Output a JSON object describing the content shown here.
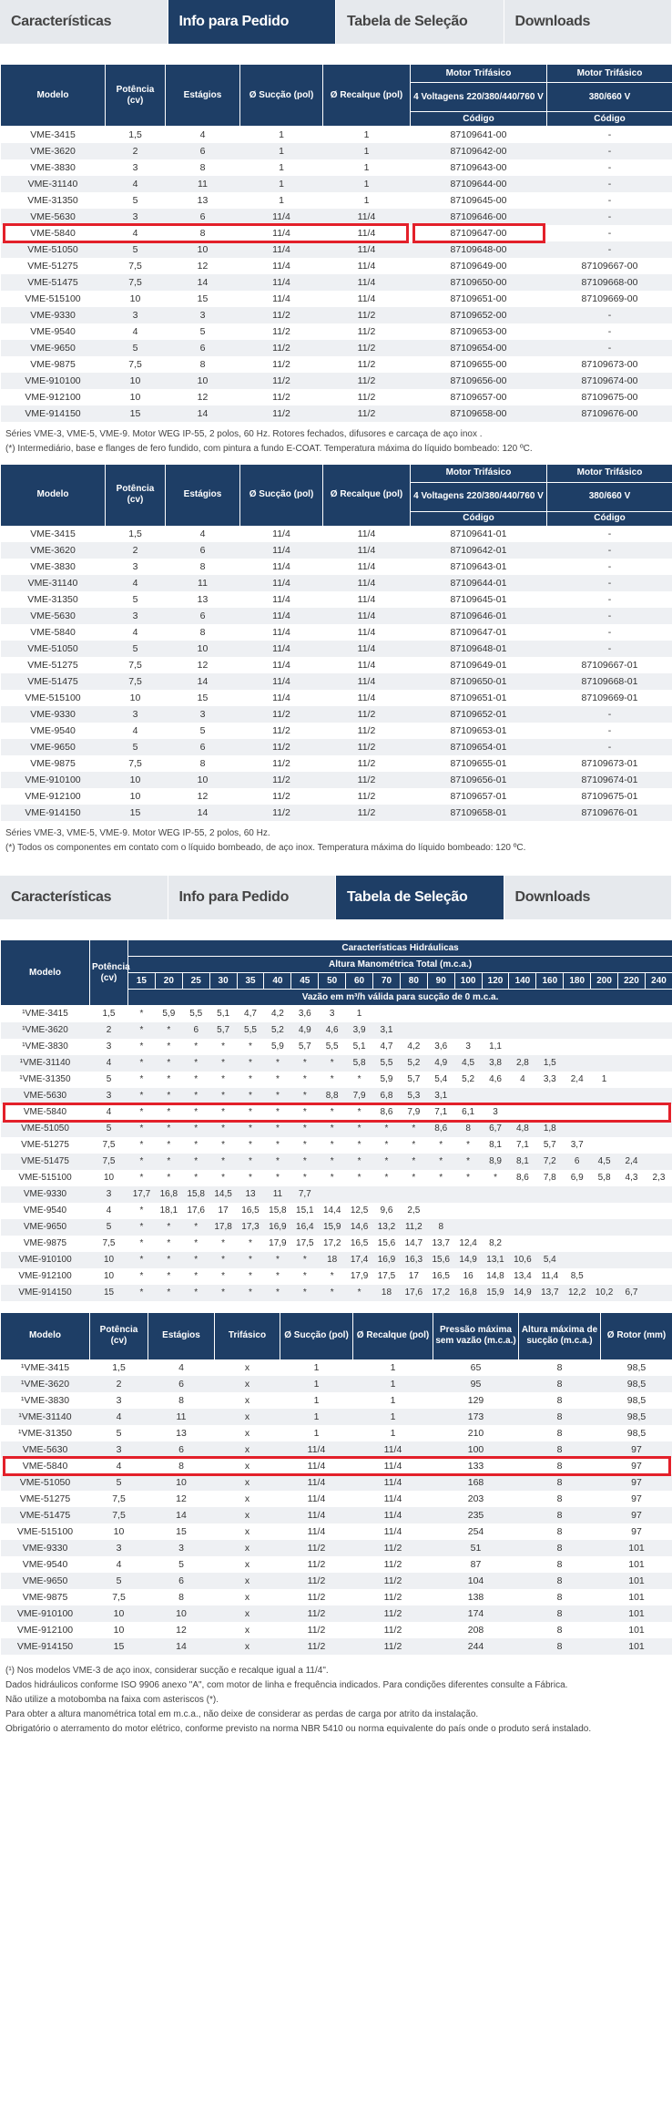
{
  "tabs": [
    "Características",
    "Info para Pedido",
    "Tabela de Seleção",
    "Downloads"
  ],
  "order_head": {
    "modelo": "Modelo",
    "potencia": "Potência (cv)",
    "estagios": "Estágios",
    "succao": "Ø Sucção (pol)",
    "recalque": "Ø Recalque (pol)",
    "motor1": "Motor Trifásico",
    "motor1_sub": "4 Voltagens 220/380/440/760 V",
    "motor2": "Motor Trifásico",
    "motor2_sub": "380/660 V",
    "codigo": "Código"
  },
  "order1": [
    [
      "VME-3415",
      "1,5",
      "4",
      "1",
      "1",
      "87109641-00",
      "-"
    ],
    [
      "VME-3620",
      "2",
      "6",
      "1",
      "1",
      "87109642-00",
      "-"
    ],
    [
      "VME-3830",
      "3",
      "8",
      "1",
      "1",
      "87109643-00",
      "-"
    ],
    [
      "VME-31140",
      "4",
      "11",
      "1",
      "1",
      "87109644-00",
      "-"
    ],
    [
      "VME-31350",
      "5",
      "13",
      "1",
      "1",
      "87109645-00",
      "-"
    ],
    [
      "VME-5630",
      "3",
      "6",
      "11/4",
      "11/4",
      "87109646-00",
      "-"
    ],
    [
      "VME-5840",
      "4",
      "8",
      "11/4",
      "11/4",
      "87109647-00",
      "-"
    ],
    [
      "VME-51050",
      "5",
      "10",
      "11/4",
      "11/4",
      "87109648-00",
      "-"
    ],
    [
      "VME-51275",
      "7,5",
      "12",
      "11/4",
      "11/4",
      "87109649-00",
      "87109667-00"
    ],
    [
      "VME-51475",
      "7,5",
      "14",
      "11/4",
      "11/4",
      "87109650-00",
      "87109668-00"
    ],
    [
      "VME-515100",
      "10",
      "15",
      "11/4",
      "11/4",
      "87109651-00",
      "87109669-00"
    ],
    [
      "VME-9330",
      "3",
      "3",
      "11/2",
      "11/2",
      "87109652-00",
      "-"
    ],
    [
      "VME-9540",
      "4",
      "5",
      "11/2",
      "11/2",
      "87109653-00",
      "-"
    ],
    [
      "VME-9650",
      "5",
      "6",
      "11/2",
      "11/2",
      "87109654-00",
      "-"
    ],
    [
      "VME-9875",
      "7,5",
      "8",
      "11/2",
      "11/2",
      "87109655-00",
      "87109673-00"
    ],
    [
      "VME-910100",
      "10",
      "10",
      "11/2",
      "11/2",
      "87109656-00",
      "87109674-00"
    ],
    [
      "VME-912100",
      "10",
      "12",
      "11/2",
      "11/2",
      "87109657-00",
      "87109675-00"
    ],
    [
      "VME-914150",
      "15",
      "14",
      "11/2",
      "11/2",
      "87109658-00",
      "87109676-00"
    ]
  ],
  "order1_notes": [
    "Séries VME-3, VME-5, VME-9. Motor WEG IP-55, 2 polos, 60 Hz. Rotores fechados, difusores e carcaça de aço inox .",
    "(*) Intermediário, base e flanges de fero fundido, com pintura a fundo E-COAT. Temperatura máxima do líquido bombeado: 120 ºC."
  ],
  "order2": [
    [
      "VME-3415",
      "1,5",
      "4",
      "11/4",
      "11/4",
      "87109641-01",
      "-"
    ],
    [
      "VME-3620",
      "2",
      "6",
      "11/4",
      "11/4",
      "87109642-01",
      "-"
    ],
    [
      "VME-3830",
      "3",
      "8",
      "11/4",
      "11/4",
      "87109643-01",
      "-"
    ],
    [
      "VME-31140",
      "4",
      "11",
      "11/4",
      "11/4",
      "87109644-01",
      "-"
    ],
    [
      "VME-31350",
      "5",
      "13",
      "11/4",
      "11/4",
      "87109645-01",
      "-"
    ],
    [
      "VME-5630",
      "3",
      "6",
      "11/4",
      "11/4",
      "87109646-01",
      "-"
    ],
    [
      "VME-5840",
      "4",
      "8",
      "11/4",
      "11/4",
      "87109647-01",
      "-"
    ],
    [
      "VME-51050",
      "5",
      "10",
      "11/4",
      "11/4",
      "87109648-01",
      "-"
    ],
    [
      "VME-51275",
      "7,5",
      "12",
      "11/4",
      "11/4",
      "87109649-01",
      "87109667-01"
    ],
    [
      "VME-51475",
      "7,5",
      "14",
      "11/4",
      "11/4",
      "87109650-01",
      "87109668-01"
    ],
    [
      "VME-515100",
      "10",
      "15",
      "11/4",
      "11/4",
      "87109651-01",
      "87109669-01"
    ],
    [
      "VME-9330",
      "3",
      "3",
      "11/2",
      "11/2",
      "87109652-01",
      "-"
    ],
    [
      "VME-9540",
      "4",
      "5",
      "11/2",
      "11/2",
      "87109653-01",
      "-"
    ],
    [
      "VME-9650",
      "5",
      "6",
      "11/2",
      "11/2",
      "87109654-01",
      "-"
    ],
    [
      "VME-9875",
      "7,5",
      "8",
      "11/2",
      "11/2",
      "87109655-01",
      "87109673-01"
    ],
    [
      "VME-910100",
      "10",
      "10",
      "11/2",
      "11/2",
      "87109656-01",
      "87109674-01"
    ],
    [
      "VME-912100",
      "10",
      "12",
      "11/2",
      "11/2",
      "87109657-01",
      "87109675-01"
    ],
    [
      "VME-914150",
      "15",
      "14",
      "11/2",
      "11/2",
      "87109658-01",
      "87109676-01"
    ]
  ],
  "order2_notes": [
    "Séries VME-3, VME-5, VME-9. Motor WEG IP-55, 2 polos, 60 Hz.",
    "(*) Todos os componentes em contato com o líquido bombeado, de aço inox. Temperatura máxima do líquido bombeado: 120 ºC."
  ],
  "sel_head": {
    "modelo": "Modelo",
    "potencia": "Potência (cv)",
    "caract": "Características Hidráulicas",
    "altura": "Altura Manométrica Total (m.c.a.)",
    "vazao": "Vazão em m³/h válida para sucção de 0 m.c.a.",
    "cols": [
      "15",
      "20",
      "25",
      "30",
      "35",
      "40",
      "45",
      "50",
      "60",
      "70",
      "80",
      "90",
      "100",
      "120",
      "140",
      "160",
      "180",
      "200",
      "220",
      "240"
    ]
  },
  "sel": [
    [
      "¹VME-3415",
      "1,5",
      "*",
      "5,9",
      "5,5",
      "5,1",
      "4,7",
      "4,2",
      "3,6",
      "3",
      "1",
      "",
      "",
      "",
      "",
      "",
      "",
      "",
      "",
      "",
      "",
      ""
    ],
    [
      "¹VME-3620",
      "2",
      "*",
      "*",
      "6",
      "5,7",
      "5,5",
      "5,2",
      "4,9",
      "4,6",
      "3,9",
      "3,1",
      "",
      "",
      "",
      "",
      "",
      "",
      "",
      "",
      "",
      ""
    ],
    [
      "¹VME-3830",
      "3",
      "*",
      "*",
      "*",
      "*",
      "*",
      "5,9",
      "5,7",
      "5,5",
      "5,1",
      "4,7",
      "4,2",
      "3,6",
      "3",
      "1,1",
      "",
      "",
      "",
      "",
      "",
      ""
    ],
    [
      "¹VME-31140",
      "4",
      "*",
      "*",
      "*",
      "*",
      "*",
      "*",
      "*",
      "*",
      "5,8",
      "5,5",
      "5,2",
      "4,9",
      "4,5",
      "3,8",
      "2,8",
      "1,5",
      "",
      "",
      "",
      ""
    ],
    [
      "¹VME-31350",
      "5",
      "*",
      "*",
      "*",
      "*",
      "*",
      "*",
      "*",
      "*",
      "*",
      "5,9",
      "5,7",
      "5,4",
      "5,2",
      "4,6",
      "4",
      "3,3",
      "2,4",
      "1",
      "",
      ""
    ],
    [
      "VME-5630",
      "3",
      "*",
      "*",
      "*",
      "*",
      "*",
      "*",
      "*",
      "8,8",
      "7,9",
      "6,8",
      "5,3",
      "3,1",
      "",
      "",
      "",
      "",
      "",
      "",
      "",
      ""
    ],
    [
      "VME-5840",
      "4",
      "*",
      "*",
      "*",
      "*",
      "*",
      "*",
      "*",
      "*",
      "*",
      "8,6",
      "7,9",
      "7,1",
      "6,1",
      "3",
      "",
      "",
      "",
      "",
      "",
      ""
    ],
    [
      "VME-51050",
      "5",
      "*",
      "*",
      "*",
      "*",
      "*",
      "*",
      "*",
      "*",
      "*",
      "*",
      "*",
      "8,6",
      "8",
      "6,7",
      "4,8",
      "1,8",
      "",
      "",
      "",
      ""
    ],
    [
      "VME-51275",
      "7,5",
      "*",
      "*",
      "*",
      "*",
      "*",
      "*",
      "*",
      "*",
      "*",
      "*",
      "*",
      "*",
      "*",
      "8,1",
      "7,1",
      "5,7",
      "3,7",
      "",
      "",
      ""
    ],
    [
      "VME-51475",
      "7,5",
      "*",
      "*",
      "*",
      "*",
      "*",
      "*",
      "*",
      "*",
      "*",
      "*",
      "*",
      "*",
      "*",
      "8,9",
      "8,1",
      "7,2",
      "6",
      "4,5",
      "2,4",
      ""
    ],
    [
      "VME-515100",
      "10",
      "*",
      "*",
      "*",
      "*",
      "*",
      "*",
      "*",
      "*",
      "*",
      "*",
      "*",
      "*",
      "*",
      "*",
      "8,6",
      "7,8",
      "6,9",
      "5,8",
      "4,3",
      "2,3"
    ],
    [
      "VME-9330",
      "3",
      "17,7",
      "16,8",
      "15,8",
      "14,5",
      "13",
      "11",
      "7,7",
      "",
      "",
      "",
      "",
      "",
      "",
      "",
      "",
      "",
      "",
      "",
      "",
      ""
    ],
    [
      "VME-9540",
      "4",
      "*",
      "18,1",
      "17,6",
      "17",
      "16,5",
      "15,8",
      "15,1",
      "14,4",
      "12,5",
      "9,6",
      "2,5",
      "",
      "",
      "",
      "",
      "",
      "",
      "",
      "",
      ""
    ],
    [
      "VME-9650",
      "5",
      "*",
      "*",
      "*",
      "17,8",
      "17,3",
      "16,9",
      "16,4",
      "15,9",
      "14,6",
      "13,2",
      "11,2",
      "8",
      "",
      "",
      "",
      "",
      "",
      "",
      "",
      ""
    ],
    [
      "VME-9875",
      "7,5",
      "*",
      "*",
      "*",
      "*",
      "*",
      "17,9",
      "17,5",
      "17,2",
      "16,5",
      "15,6",
      "14,7",
      "13,7",
      "12,4",
      "8,2",
      "",
      "",
      "",
      "",
      "",
      ""
    ],
    [
      "VME-910100",
      "10",
      "*",
      "*",
      "*",
      "*",
      "*",
      "*",
      "*",
      "18",
      "17,4",
      "16,9",
      "16,3",
      "15,6",
      "14,9",
      "13,1",
      "10,6",
      "5,4",
      "",
      "",
      "",
      ""
    ],
    [
      "VME-912100",
      "10",
      "*",
      "*",
      "*",
      "*",
      "*",
      "*",
      "*",
      "*",
      "17,9",
      "17,5",
      "17",
      "16,5",
      "16",
      "14,8",
      "13,4",
      "11,4",
      "8,5",
      "",
      "",
      ""
    ],
    [
      "VME-914150",
      "15",
      "*",
      "*",
      "*",
      "*",
      "*",
      "*",
      "*",
      "*",
      "*",
      "18",
      "17,6",
      "17,2",
      "16,8",
      "15,9",
      "14,9",
      "13,7",
      "12,2",
      "10,2",
      "6,7",
      ""
    ]
  ],
  "spec_head": {
    "modelo": "Modelo",
    "potencia": "Potência (cv)",
    "estagios": "Estágios",
    "trifasico": "Trifásico",
    "succao": "Ø Sucção (pol)",
    "recalque": "Ø Recalque (pol)",
    "pressao": "Pressão máxima sem vazão (m.c.a.)",
    "altura": "Altura máxima de sucção (m.c.a.)",
    "rotor": "Ø Rotor (mm)"
  },
  "spec": [
    [
      "¹VME-3415",
      "1,5",
      "4",
      "x",
      "1",
      "1",
      "65",
      "8",
      "98,5"
    ],
    [
      "¹VME-3620",
      "2",
      "6",
      "x",
      "1",
      "1",
      "95",
      "8",
      "98,5"
    ],
    [
      "¹VME-3830",
      "3",
      "8",
      "x",
      "1",
      "1",
      "129",
      "8",
      "98,5"
    ],
    [
      "¹VME-31140",
      "4",
      "11",
      "x",
      "1",
      "1",
      "173",
      "8",
      "98,5"
    ],
    [
      "¹VME-31350",
      "5",
      "13",
      "x",
      "1",
      "1",
      "210",
      "8",
      "98,5"
    ],
    [
      "VME-5630",
      "3",
      "6",
      "x",
      "11/4",
      "11/4",
      "100",
      "8",
      "97"
    ],
    [
      "VME-5840",
      "4",
      "8",
      "x",
      "11/4",
      "11/4",
      "133",
      "8",
      "97"
    ],
    [
      "VME-51050",
      "5",
      "10",
      "x",
      "11/4",
      "11/4",
      "168",
      "8",
      "97"
    ],
    [
      "VME-51275",
      "7,5",
      "12",
      "x",
      "11/4",
      "11/4",
      "203",
      "8",
      "97"
    ],
    [
      "VME-51475",
      "7,5",
      "14",
      "x",
      "11/4",
      "11/4",
      "235",
      "8",
      "97"
    ],
    [
      "VME-515100",
      "10",
      "15",
      "x",
      "11/4",
      "11/4",
      "254",
      "8",
      "97"
    ],
    [
      "VME-9330",
      "3",
      "3",
      "x",
      "11/2",
      "11/2",
      "51",
      "8",
      "101"
    ],
    [
      "VME-9540",
      "4",
      "5",
      "x",
      "11/2",
      "11/2",
      "87",
      "8",
      "101"
    ],
    [
      "VME-9650",
      "5",
      "6",
      "x",
      "11/2",
      "11/2",
      "104",
      "8",
      "101"
    ],
    [
      "VME-9875",
      "7,5",
      "8",
      "x",
      "11/2",
      "11/2",
      "138",
      "8",
      "101"
    ],
    [
      "VME-910100",
      "10",
      "10",
      "x",
      "11/2",
      "11/2",
      "174",
      "8",
      "101"
    ],
    [
      "VME-912100",
      "10",
      "12",
      "x",
      "11/2",
      "11/2",
      "208",
      "8",
      "101"
    ],
    [
      "VME-914150",
      "15",
      "14",
      "x",
      "11/2",
      "11/2",
      "244",
      "8",
      "101"
    ]
  ],
  "spec_notes": [
    "(¹) Nos modelos VME-3 de aço inox, considerar sucção e recalque igual a 11/4\".",
    "Dados hidráulicos conforme ISO 9906 anexo \"A\", com motor de linha e frequência indicados. Para condições diferentes consulte a Fábrica.",
    "Não utilize a motobomba na faixa com asteriscos (*).",
    "Para obter a altura manométrica total em m.c.a., não deixe de considerar as perdas de carga por atrito da instalação.",
    "Obrigatório o aterramento do motor elétrico, conforme previsto na norma NBR 5410 ou norma equivalente do país onde o produto será instalado."
  ],
  "highlight_color": "#e3202a",
  "header_color": "#1e3e66"
}
